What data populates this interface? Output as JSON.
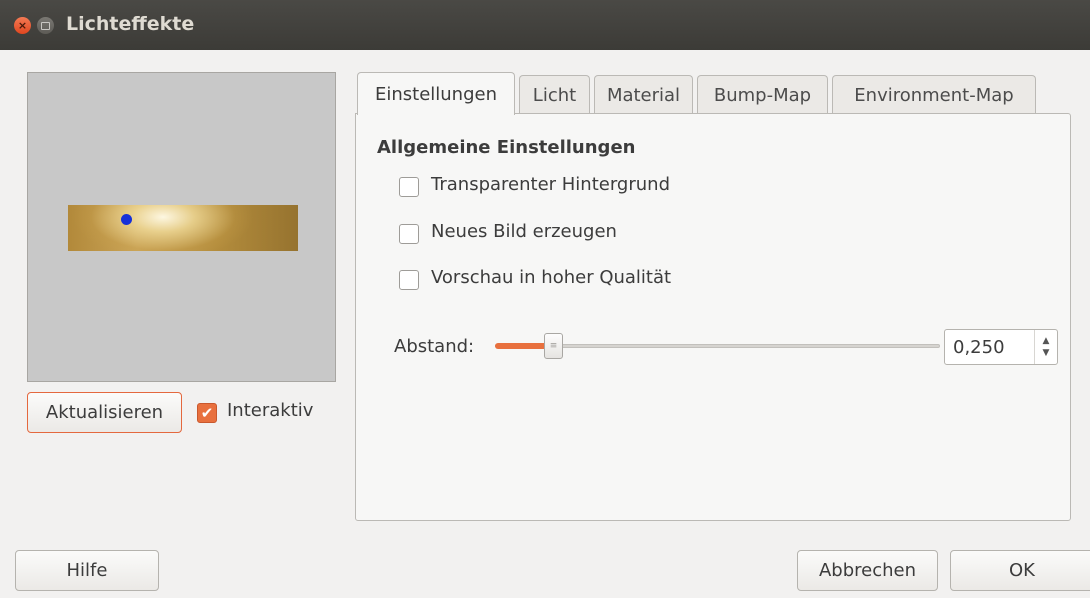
{
  "window": {
    "title": "Lichteffekte",
    "close_icon": "close-icon",
    "maximize_icon": "maximize-icon"
  },
  "preview": {
    "update_label": "Aktualisieren",
    "interactive_label": "Interaktiv",
    "interactive_checked": true
  },
  "tabs": [
    {
      "label": "Einstellungen",
      "active": true
    },
    {
      "label": "Licht",
      "active": false
    },
    {
      "label": "Material",
      "active": false
    },
    {
      "label": "Bump-Map",
      "active": false
    },
    {
      "label": "Environment-Map",
      "active": false
    }
  ],
  "settings": {
    "section_title": "Allgemeine Einstellungen",
    "options": [
      {
        "label": "Transparenter Hintergrund",
        "checked": false
      },
      {
        "label": "Neues Bild erzeugen",
        "checked": false
      },
      {
        "label": "Vorschau in hoher Qualität",
        "checked": false
      }
    ],
    "distance": {
      "label": "Abstand:",
      "value": "0,250"
    }
  },
  "footer": {
    "help_label": "Hilfe",
    "cancel_label": "Abbrechen",
    "ok_label": "OK"
  },
  "colors": {
    "accent": "#e8703e",
    "titlebar": "#3c3b37",
    "light_marker": "#1630d8"
  }
}
